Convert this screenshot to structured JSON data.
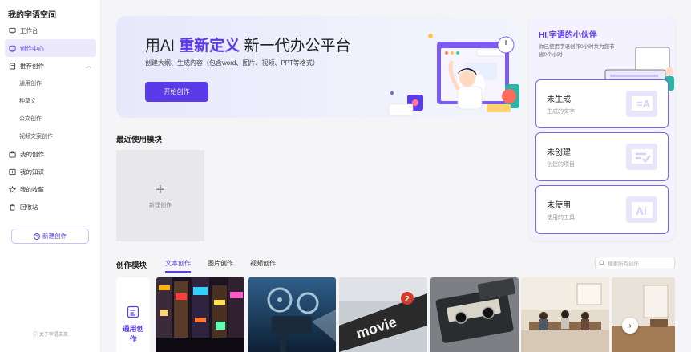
{
  "sidebar": {
    "brand": "我的字语空间",
    "items": [
      {
        "label": "工作台"
      },
      {
        "label": "创作中心"
      },
      {
        "label": "推荐创作"
      },
      {
        "label": "通用创作"
      },
      {
        "label": "种草文"
      },
      {
        "label": "公文创作"
      },
      {
        "label": "视频文案创作"
      },
      {
        "label": "我的创作"
      },
      {
        "label": "我的知识"
      },
      {
        "label": "我的收藏"
      },
      {
        "label": "回收站"
      }
    ],
    "new_button": "新建创作",
    "about": "关于字语未来"
  },
  "hero": {
    "title_prefix": "用AI ",
    "title_highlight": "重新定义",
    "title_suffix": " 新一代办公平台",
    "subtitle": "创建大纲、生成内容（包含word、图片、视频、PPT等格式）",
    "button": "开始创作"
  },
  "panel": {
    "title": "HI,字语的小伙伴",
    "text": "你已使用字语创作0小时共为您节省0个小时",
    "cards": [
      {
        "title": "未生成",
        "sub": "生成的文字"
      },
      {
        "title": "未创建",
        "sub": "创建的项目"
      },
      {
        "title": "未使用",
        "sub": "使用的工具"
      }
    ]
  },
  "recent": {
    "title": "最近使用模块",
    "new_label": "新建创作"
  },
  "modules": {
    "title": "创作模块",
    "tabs": [
      "文本创作",
      "图片创作",
      "视频创作"
    ],
    "search_placeholder": "搜索所有创作",
    "side_label": "通用创作"
  },
  "colors": {
    "accent": "#5b3be8",
    "accent_light": "#ece9fd"
  }
}
